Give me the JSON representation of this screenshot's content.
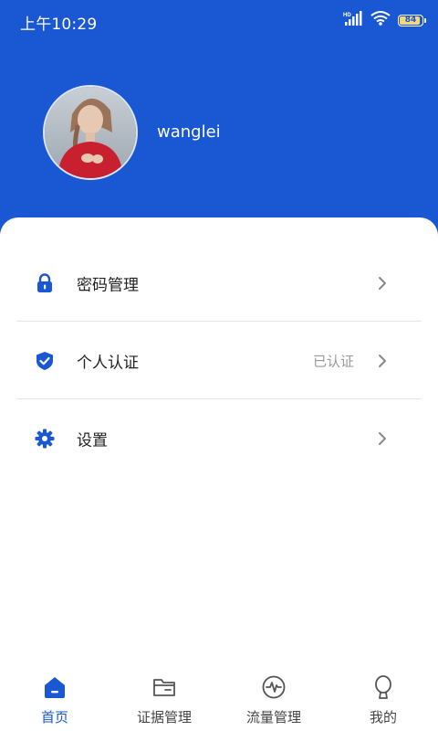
{
  "status_bar": {
    "time": "上午10:29",
    "network_label": "HD",
    "battery": "84"
  },
  "profile": {
    "username": "wanglei"
  },
  "menu": {
    "password": {
      "label": "密码管理",
      "icon": "lock-icon"
    },
    "verify": {
      "label": "个人认证",
      "value": "已认证",
      "icon": "shield-check-icon"
    },
    "settings": {
      "label": "设置",
      "icon": "gear-icon"
    }
  },
  "tabs": [
    {
      "label": "首页",
      "icon": "home-icon",
      "active": true
    },
    {
      "label": "证据管理",
      "icon": "folder-icon",
      "active": false
    },
    {
      "label": "流量管理",
      "icon": "pulse-icon",
      "active": false
    },
    {
      "label": "我的",
      "icon": "person-icon",
      "active": false
    }
  ],
  "colors": {
    "primary": "#1a57d3",
    "background": "#f8f8fb",
    "text": "#222222",
    "secondary_text": "#999999"
  }
}
